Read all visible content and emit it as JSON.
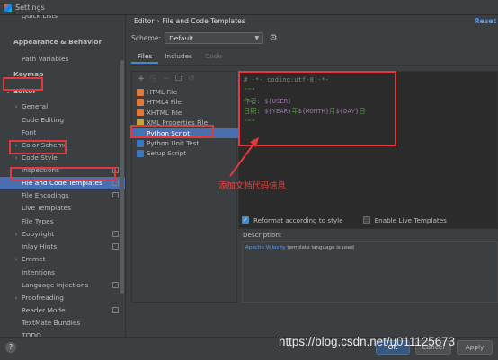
{
  "window": {
    "title": "Settings"
  },
  "sidebar": {
    "items": [
      {
        "label": "Quick Lists",
        "indent": 1
      },
      {
        "label": "Appearance & Behavior",
        "indent": 0,
        "bold": true
      },
      {
        "label": "Path Variables",
        "indent": 1
      },
      {
        "label": "Keymap",
        "indent": 0,
        "bold": true
      },
      {
        "label": "Editor",
        "indent": 0,
        "bold": true,
        "expanded": true
      },
      {
        "label": "General",
        "indent": 1,
        "collapsed": true
      },
      {
        "label": "Code Editing",
        "indent": 1
      },
      {
        "label": "Font",
        "indent": 1
      },
      {
        "label": "Color Scheme",
        "indent": 1,
        "collapsed": true
      },
      {
        "label": "Code Style",
        "indent": 1,
        "collapsed": true
      },
      {
        "label": "Inspections",
        "indent": 1,
        "copy": true
      },
      {
        "label": "File and Code Templates",
        "indent": 1,
        "copy": true,
        "selected": true
      },
      {
        "label": "File Encodings",
        "indent": 1,
        "copy": true
      },
      {
        "label": "Live Templates",
        "indent": 1
      },
      {
        "label": "File Types",
        "indent": 1
      },
      {
        "label": "Copyright",
        "indent": 1,
        "collapsed": true,
        "copy": true
      },
      {
        "label": "Inlay Hints",
        "indent": 1,
        "copy": true
      },
      {
        "label": "Emmet",
        "indent": 1,
        "collapsed": true
      },
      {
        "label": "Intentions",
        "indent": 1
      },
      {
        "label": "Language Injections",
        "indent": 1,
        "copy": true
      },
      {
        "label": "Proofreading",
        "indent": 1,
        "collapsed": true
      },
      {
        "label": "Reader Mode",
        "indent": 1,
        "copy": true
      },
      {
        "label": "TextMate Bundles",
        "indent": 1
      },
      {
        "label": "TODO",
        "indent": 1
      }
    ]
  },
  "content": {
    "breadcrumb": [
      "Editor",
      "File and Code Templates"
    ],
    "reset_label": "Reset",
    "scheme_label": "Scheme:",
    "scheme_value": "Default",
    "tabs": [
      {
        "label": "Files",
        "state": "active"
      },
      {
        "label": "Includes",
        "state": "normal"
      },
      {
        "label": "Code",
        "state": "disabled"
      }
    ],
    "toolbar_icons": [
      "add-icon",
      "copy-template-icon",
      "remove-icon",
      "duplicate-icon",
      "reset-icon"
    ],
    "files": [
      {
        "label": "HTML File",
        "color": "#e07a3a"
      },
      {
        "label": "HTML4 File",
        "color": "#e07a3a"
      },
      {
        "label": "XHTML File",
        "color": "#e07a3a"
      },
      {
        "label": "XML Properties File",
        "color": "#c9a23a"
      },
      {
        "label": "Python Script",
        "color": "#3b77bd",
        "selected": true
      },
      {
        "label": "Python Unit Test",
        "color": "#3b77bd"
      },
      {
        "label": "Setup Script",
        "color": "#3b77bd"
      }
    ],
    "editor": {
      "lines": [
        [
          {
            "t": "# -*- coding:utf-8 -*-",
            "c": "comment"
          }
        ],
        [
          {
            "t": "\"\"\"",
            "c": "doc"
          }
        ],
        [
          {
            "t": "作者: ",
            "c": "doc"
          },
          {
            "t": "${USER}",
            "c": "var"
          }
        ],
        [
          {
            "t": "日期: ",
            "c": "doc"
          },
          {
            "t": "${YEAR}",
            "c": "var"
          },
          {
            "t": "年",
            "c": "doc"
          },
          {
            "t": "${MONTH}",
            "c": "var"
          },
          {
            "t": "月",
            "c": "doc"
          },
          {
            "t": "${DAY}",
            "c": "var"
          },
          {
            "t": "日",
            "c": "doc"
          }
        ],
        [
          {
            "t": "\"\"\"",
            "c": "doc"
          }
        ]
      ]
    },
    "reformat_label": "Reformat according to style",
    "reformat_checked": true,
    "live_templates_label": "Enable Live Templates",
    "live_templates_checked": false,
    "description_label": "Description:",
    "description_link": "Apache Velocity",
    "description_text": " template language is used"
  },
  "annotation": {
    "text": "添加文档代码信息",
    "color": "#e03a3a"
  },
  "buttons": {
    "ok": "OK",
    "cancel": "Cancel",
    "apply": "Apply",
    "help": "?"
  },
  "watermark": "https://blog.csdn.net/u011125673"
}
